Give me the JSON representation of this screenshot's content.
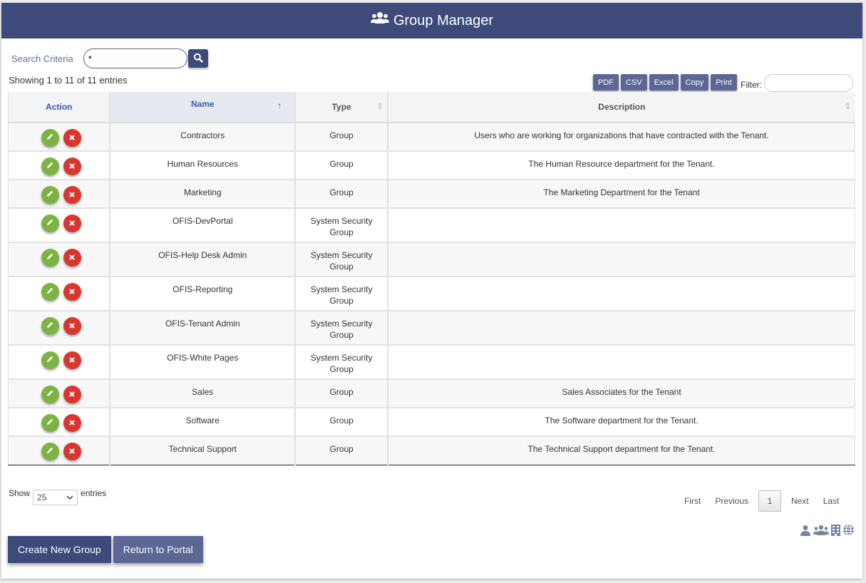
{
  "header": {
    "title": "Group Manager",
    "icon": "users-icon"
  },
  "search": {
    "label": "Search Criteria",
    "value": "*",
    "button_icon": "search-icon"
  },
  "info": {
    "showing": "Showing 1 to 11 of 11 entries"
  },
  "export": {
    "buttons": [
      "PDF",
      "CSV",
      "Excel",
      "Copy",
      "Print"
    ]
  },
  "filter": {
    "label": "Filter:",
    "value": ""
  },
  "table": {
    "columns": [
      "Action",
      "Name",
      "Type",
      "Description"
    ],
    "sorted_column": "Name",
    "sort_direction": "ascending",
    "rows": [
      {
        "name": "Contractors",
        "type": "Group",
        "description": "Users who are working for organizations that have contracted with the Tenant."
      },
      {
        "name": "Human Resources",
        "type": "Group",
        "description": "The Human Resource department for the Tenant."
      },
      {
        "name": "Marketing",
        "type": "Group",
        "description": "The Marketing Department for the Tenant"
      },
      {
        "name": "OFIS-DevPortal",
        "type": "System Security Group",
        "description": ""
      },
      {
        "name": "OFIS-Help Desk Admin",
        "type": "System Security Group",
        "description": ""
      },
      {
        "name": "OFIS-Reporting",
        "type": "System Security Group",
        "description": ""
      },
      {
        "name": "OFIS-Tenant Admin",
        "type": "System Security Group",
        "description": ""
      },
      {
        "name": "OFIS-White Pages",
        "type": "System Security Group",
        "description": ""
      },
      {
        "name": "Sales",
        "type": "Group",
        "description": "Sales Associates for the Tenant"
      },
      {
        "name": "Software",
        "type": "Group",
        "description": "The Software department for the Tenant."
      },
      {
        "name": "Technical Support",
        "type": "Group",
        "description": "The Technical Support department for the Tenant."
      }
    ]
  },
  "length": {
    "show_label": "Show",
    "selected": "25",
    "entries_label": "entries"
  },
  "pagination": {
    "first": "First",
    "previous": "Previous",
    "current": "1",
    "next": "Next",
    "last": "Last"
  },
  "legend_icons": [
    "user-icon",
    "users-icon",
    "building-icon",
    "globe-icon"
  ],
  "actions": {
    "create": "Create New Group",
    "return": "Return to Portal"
  },
  "colors": {
    "header_bg": "#3d4a7a",
    "export_btn": "#5c6795",
    "edit": "#7cb342",
    "delete": "#d8362f"
  }
}
